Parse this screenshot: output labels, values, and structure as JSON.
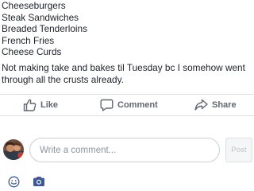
{
  "post": {
    "lines": [
      "Cheeseburgers",
      "Steak Sandwiches",
      "Breaded Tenderloins",
      "French Fries",
      "Cheese Curds"
    ],
    "note": "Not making take and bakes til Tuesday bc I somehow went through all the crusts already."
  },
  "actions": {
    "like_label": "Like",
    "comment_label": "Comment",
    "share_label": "Share"
  },
  "composer": {
    "placeholder": "Write a comment...",
    "post_label": "Post"
  },
  "icons": {
    "like": "thumbs-up-icon",
    "comment": "speech-bubble-icon",
    "share": "share-arrow-icon",
    "emoji": "smiley-icon",
    "camera": "camera-icon"
  },
  "colors": {
    "action_text": "#606770",
    "divider": "#dddfe2",
    "tool_icon": "#3b5998"
  }
}
